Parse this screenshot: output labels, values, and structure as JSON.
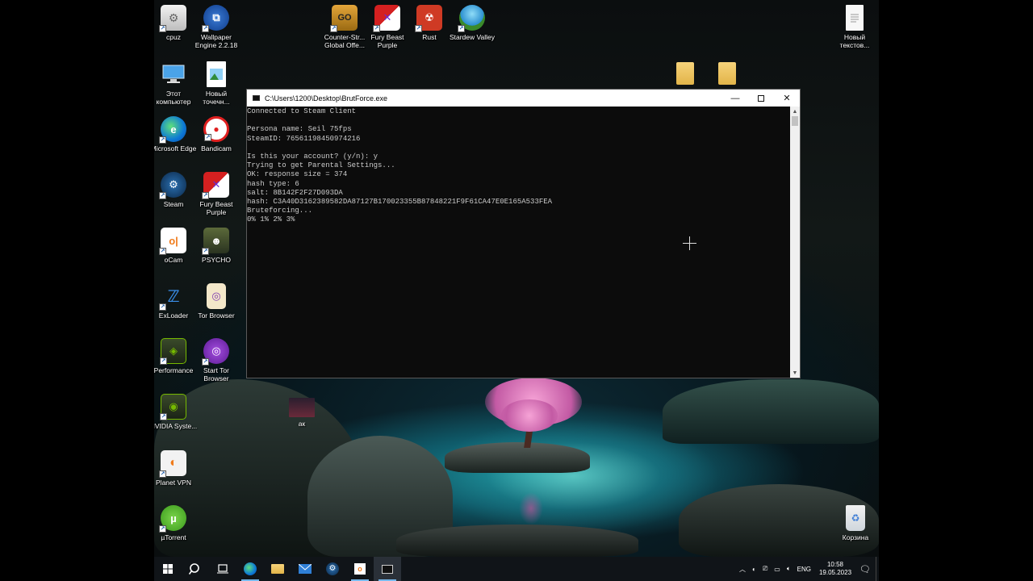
{
  "desktop": {
    "icons_left": [
      {
        "label": "cpuz",
        "icon": "cpuz-icon"
      },
      {
        "label": "Wallpaper Engine 2.2.18",
        "icon": "wallpaper-engine-icon"
      },
      {
        "label": "Этот компьютер",
        "icon": "this-pc-icon"
      },
      {
        "label": "Новый точечн...",
        "icon": "bitmap-file-icon"
      },
      {
        "label": "Microsoft Edge",
        "icon": "edge-icon"
      },
      {
        "label": "Bandicam",
        "icon": "bandicam-icon"
      },
      {
        "label": "Steam",
        "icon": "steam-icon"
      },
      {
        "label": "Fury Beast Purple",
        "icon": "fury-beast-icon"
      },
      {
        "label": "oCam",
        "icon": "ocam-icon"
      },
      {
        "label": "PSYCHO",
        "icon": "psycho-icon"
      },
      {
        "label": "ExLoader",
        "icon": "exloader-icon"
      },
      {
        "label": "Tor Browser",
        "icon": "tor-browser-icon"
      },
      {
        "label": "Performance",
        "icon": "nvidia-performance-icon"
      },
      {
        "label": "Start Tor Browser",
        "icon": "start-tor-browser-icon"
      },
      {
        "label": "NVIDIA Syste...",
        "icon": "nvidia-system-icon"
      },
      {
        "label": "Planet VPN",
        "icon": "planet-vpn-icon"
      },
      {
        "label": "µTorrent",
        "icon": "utorrent-icon"
      }
    ],
    "icons_top": [
      {
        "label": "Counter-Str... Global Offe...",
        "icon": "csgo-icon"
      },
      {
        "label": "Fury Beast Purple",
        "icon": "fury-beast-icon"
      },
      {
        "label": "Rust",
        "icon": "rust-icon"
      },
      {
        "label": "Stardew Valley",
        "icon": "stardew-valley-icon"
      }
    ],
    "icon_right_top": {
      "label": "Новый текстов...",
      "icon": "text-file-icon"
    },
    "icon_ak": {
      "label": "ак",
      "icon": "image-file-icon"
    },
    "recycle_bin": {
      "label": "Корзина",
      "icon": "recycle-bin-icon"
    }
  },
  "console": {
    "title": "C:\\Users\\1200\\Desktop\\BrutForce.exe",
    "lines": [
      "Connected to Steam Client",
      "",
      "Persona name: Seil 75fps",
      "SteamID: 76561198450974216",
      "",
      "Is this your account? (y/n): y",
      "Trying to get Parental Settings...",
      "OK: response size = 374",
      "hash type: 6",
      "salt: 8B142F2F27D093DA",
      "hash: C3A40D3162389582DA87127B170023355B87848221F9F61CA47E0E165A533FEA",
      "Bruteforcing...",
      "0% 1% 2% 3%"
    ]
  },
  "taskbar": {
    "lang": "ENG",
    "time": "10:58",
    "date": "19.05.2023"
  },
  "colors": {
    "console_bg": "#0c0c0c",
    "console_text": "#cccccc",
    "taskbar_bg": "#101418",
    "accent": "#76b9ed"
  }
}
